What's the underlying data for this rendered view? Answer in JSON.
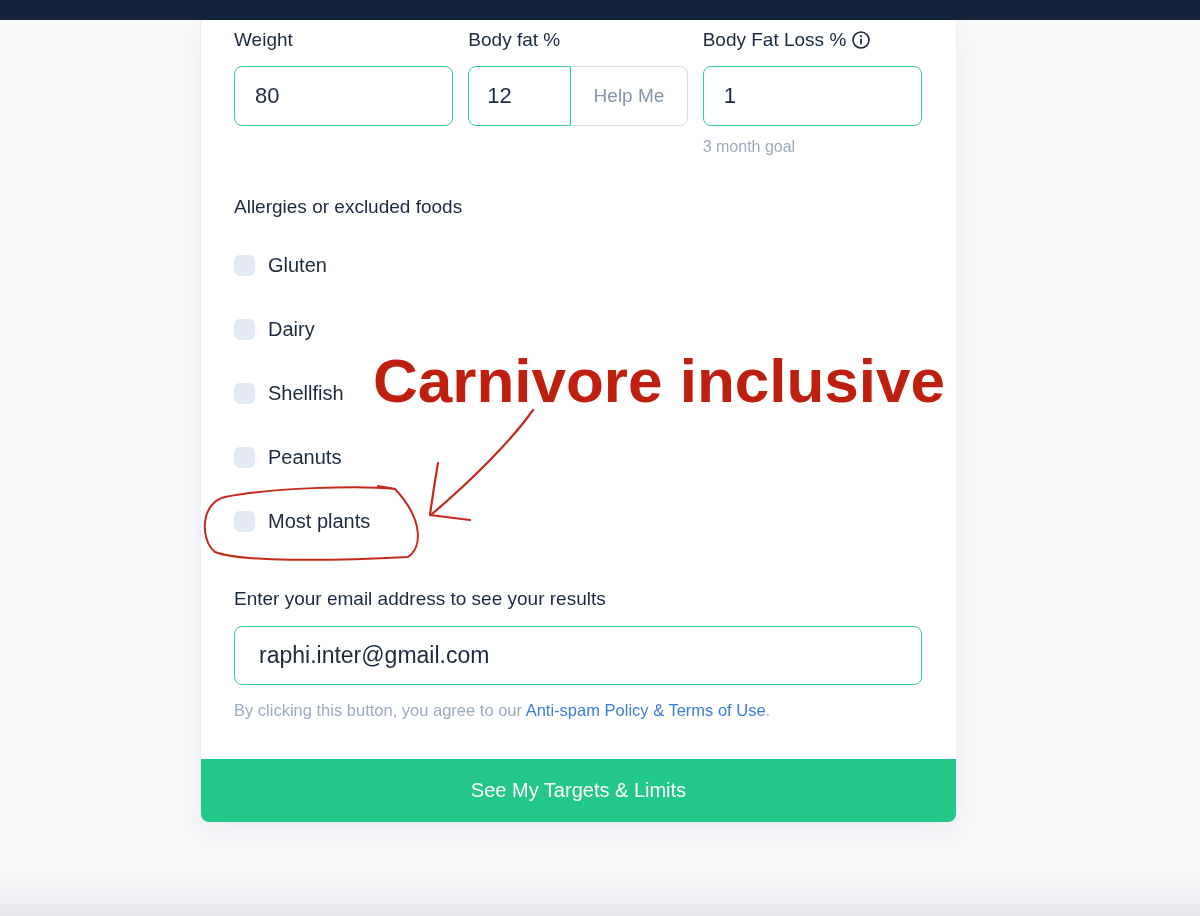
{
  "form": {
    "fields": [
      {
        "label": "Weight",
        "value": "80",
        "kind": "plain"
      },
      {
        "label": "Body fat %",
        "value": "12",
        "kind": "addon",
        "addon": "Help Me"
      },
      {
        "label": "Body Fat Loss %",
        "value": "1",
        "kind": "info",
        "hint": "3 month goal"
      }
    ],
    "allergies": {
      "label": "Allergies or excluded foods",
      "options": [
        {
          "label": "Gluten",
          "checked": false
        },
        {
          "label": "Dairy",
          "checked": false
        },
        {
          "label": "Shellfish",
          "checked": false
        },
        {
          "label": "Peanuts",
          "checked": false
        },
        {
          "label": "Most plants",
          "checked": false
        }
      ]
    },
    "email": {
      "label": "Enter your email address to see your results",
      "value": "raphi.inter@gmail.com"
    },
    "notice": {
      "text": "By clicking this button, you agree to our",
      "link": "Anti-spam Policy & Terms of Use",
      "end": "."
    },
    "submit": "See My Targets & Limits"
  },
  "annotation": {
    "text": "Carnivore inclusive"
  }
}
